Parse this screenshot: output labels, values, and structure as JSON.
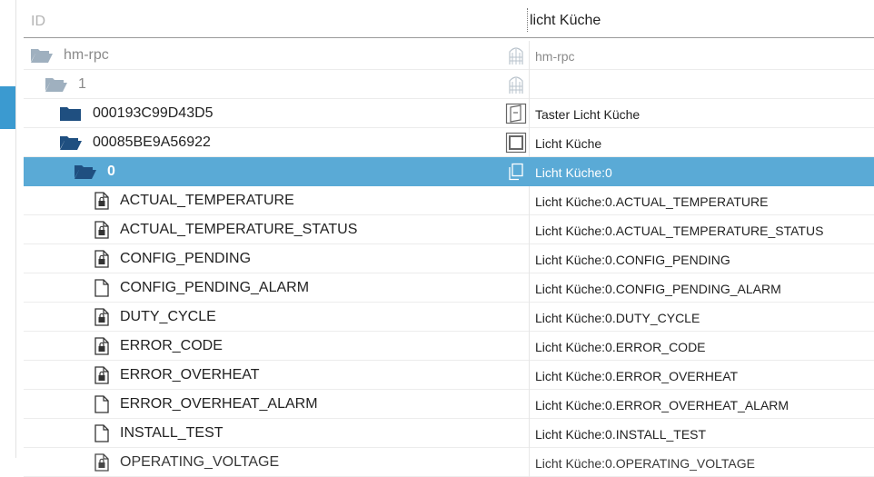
{
  "header": {
    "id_label": "ID",
    "filter_value": "licht Küche"
  },
  "colors": {
    "accent": "#3b9ad0",
    "selection": "#5aaad6",
    "folder_dark": "#1f4f80",
    "folder_grey": "#8d9fb0"
  },
  "rows": [
    {
      "id": "hm-rpc",
      "name": "hm-rpc",
      "icon": "folder-open-icon",
      "role_icon": "adapter-icon"
    },
    {
      "id": "1",
      "name": "",
      "icon": "folder-open-icon",
      "role_icon": "instance-icon"
    },
    {
      "id": "000193C99D43D5",
      "name": "Taster Licht Küche",
      "icon": "folder-closed-icon",
      "role_icon": "switch-device-icon"
    },
    {
      "id": "00085BE9A56922",
      "name": "Licht Küche",
      "icon": "folder-open-icon",
      "role_icon": "light-device-icon"
    },
    {
      "id": "0",
      "name": "Licht Küche:0",
      "icon": "folder-open-icon",
      "role_icon": "copy-icon"
    },
    {
      "id": "ACTUAL_TEMPERATURE",
      "name": "Licht Küche:0.ACTUAL_TEMPERATURE",
      "icon": "state-readonly-icon"
    },
    {
      "id": "ACTUAL_TEMPERATURE_STATUS",
      "name": "Licht Küche:0.ACTUAL_TEMPERATURE_STATUS",
      "icon": "state-readonly-icon"
    },
    {
      "id": "CONFIG_PENDING",
      "name": "Licht Küche:0.CONFIG_PENDING",
      "icon": "state-readonly-icon"
    },
    {
      "id": "CONFIG_PENDING_ALARM",
      "name": "Licht Küche:0.CONFIG_PENDING_ALARM",
      "icon": "state-icon"
    },
    {
      "id": "DUTY_CYCLE",
      "name": "Licht Küche:0.DUTY_CYCLE",
      "icon": "state-readonly-icon"
    },
    {
      "id": "ERROR_CODE",
      "name": "Licht Küche:0.ERROR_CODE",
      "icon": "state-readonly-icon"
    },
    {
      "id": "ERROR_OVERHEAT",
      "name": "Licht Küche:0.ERROR_OVERHEAT",
      "icon": "state-readonly-icon"
    },
    {
      "id": "ERROR_OVERHEAT_ALARM",
      "name": "Licht Küche:0.ERROR_OVERHEAT_ALARM",
      "icon": "state-icon"
    },
    {
      "id": "INSTALL_TEST",
      "name": "Licht Küche:0.INSTALL_TEST",
      "icon": "state-icon"
    },
    {
      "id": "OPERATING_VOLTAGE",
      "name": "Licht Küche:0.OPERATING_VOLTAGE",
      "icon": "state-readonly-icon"
    }
  ]
}
